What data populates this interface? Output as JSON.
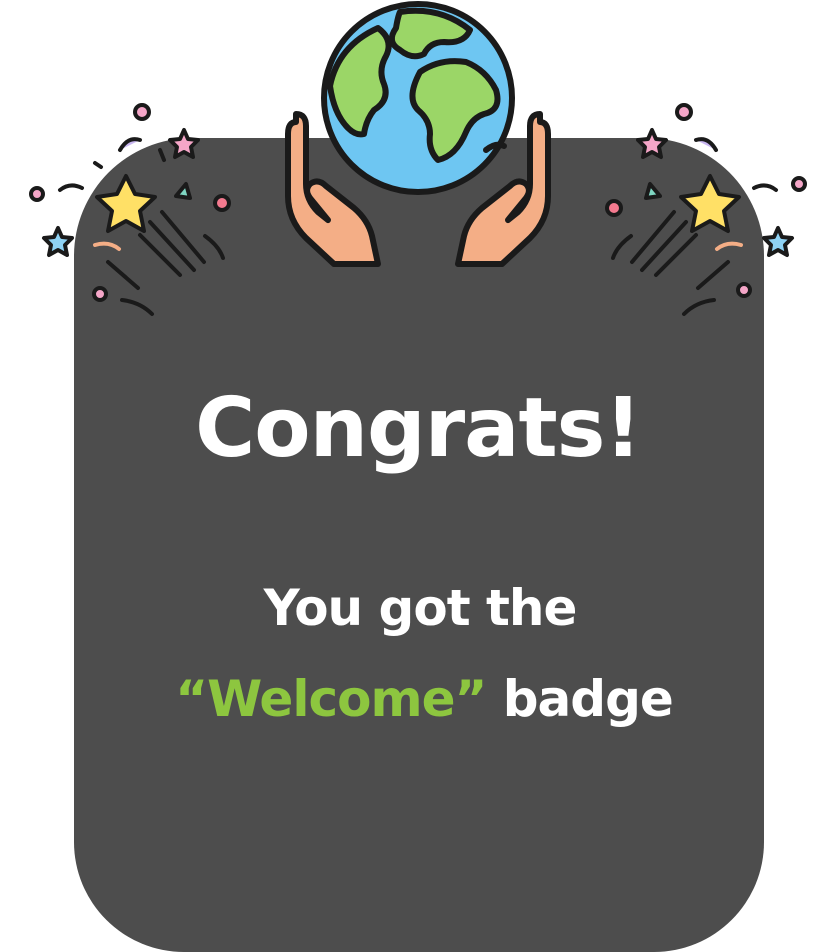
{
  "message": {
    "headline": "Congrats!",
    "line1": "You got the",
    "quote_open": "“",
    "badge_name": "Welcome",
    "quote_close": "”",
    "line2_rest": " badge"
  },
  "colors": {
    "card_background": "#4d4d4d",
    "text": "#ffffff",
    "badge_accent": "#8dc63f",
    "globe_ocean": "#6ec6f2",
    "globe_land": "#9bd667",
    "hands": "#f4ae86",
    "star": "#ffe066"
  },
  "icons": {
    "main": "globe-in-hands-icon",
    "left_decoration": "confetti-burst-icon",
    "right_decoration": "confetti-burst-icon"
  }
}
